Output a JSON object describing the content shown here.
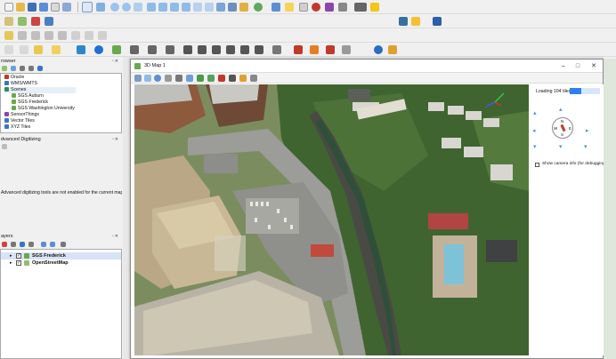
{
  "browser_panel": {
    "title": "rowser",
    "items": [
      {
        "label": "Oracle",
        "icon_color": "#c23b22"
      },
      {
        "label": "WMS/WMTS",
        "icon_color": "#3a75c4"
      },
      {
        "label": "Scenes",
        "icon_color": "#2e8b57"
      },
      {
        "label": "SGS Auburn",
        "icon_color": "#6aa84f"
      },
      {
        "label": "SGS Frederick",
        "icon_color": "#6aa84f"
      },
      {
        "label": "SGS Washington University",
        "icon_color": "#6aa84f"
      },
      {
        "label": "SensorThings",
        "icon_color": "#8e44ad"
      },
      {
        "label": "Vector Tiles",
        "icon_color": "#3a75c4"
      },
      {
        "label": "XYZ Tiles",
        "icon_color": "#3a75c4"
      }
    ]
  },
  "digitizing_panel": {
    "title": "dvanced Digitizing",
    "message": "Advanced digitizing tools are not enabled for the current map tool"
  },
  "layers_panel": {
    "title": "ayers",
    "layers": [
      {
        "name": "SGS Frederick",
        "checked": true
      },
      {
        "name": "OpenStreetMap",
        "checked": true
      }
    ]
  },
  "map_window": {
    "title": "3D Map 1",
    "loading_text": "Loading 104 tiles",
    "loading_progress": 0.38,
    "camera_info_label": "Show camera info (for debugging)",
    "compass": {
      "n": "N",
      "s": "S",
      "e": "E",
      "w": "W"
    }
  },
  "colors": {
    "accent": "#1e88e5",
    "progress": "#2f80ed",
    "toolbar_bg": "#f0f0f0"
  }
}
